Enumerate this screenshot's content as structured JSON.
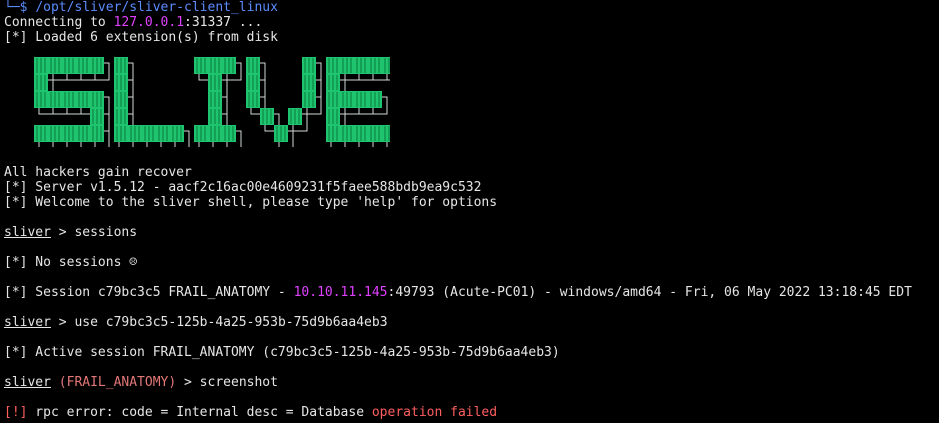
{
  "terminal": {
    "cmd_prompt_prefix": "└─$ ",
    "cmd_path": "/opt/sliver/sliver-client_linux",
    "connecting_prefix": "Connecting to ",
    "connecting_ip": "127.0.0.1",
    "connecting_port": ":31337 ...",
    "loaded_ext": "[*] Loaded 6 extension(s) from disk",
    "banner_word": "SLIVER",
    "tagline": "All hackers gain recover",
    "server_info": "[*] Server v1.5.12 - aacf2c16ac00e4609231f5faee588bdb9ea9c532",
    "welcome": "[*] Welcome to the sliver shell, please type 'help' for options",
    "prompt_label": "sliver",
    "cmd_sessions": " > sessions",
    "no_sessions": "[*] No sessions ☹",
    "session_prefix": "[*] Session c79bc3c5 FRAIL_ANATOMY - ",
    "session_ip": "10.10.11.145",
    "session_suffix": ":49793 (Acute-PC01) - windows/amd64 - Fri, 06 May 2022 13:18:45 EDT",
    "cmd_use": " > use c79bc3c5-125b-4a25-953b-75d9b6aa4eb3",
    "active_session": "[*] Active session FRAIL_ANATOMY (c79bc3c5-125b-4a25-953b-75d9b6aa4eb3)",
    "active_session_name": " (FRAIL_ANATOMY)",
    "cmd_screenshot": " > screenshot",
    "error_tag": "[!]",
    "error_text": " rpc error: code = Internal desc = Database ",
    "error_tail": "operation failed"
  },
  "colors": {
    "background": "#000000",
    "text": "#e6e6e6",
    "banner_green": "#1ec46e",
    "banner_shadow": "#cfd8d3",
    "ip_magenta": "#e040ff",
    "error_red": "#ff5f5f"
  }
}
